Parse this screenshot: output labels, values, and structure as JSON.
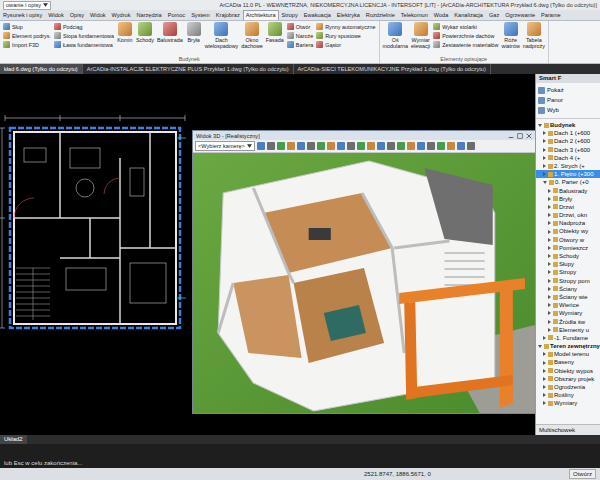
{
  "window": {
    "title": "ArCADia 11.0 PL - WEWNĘTRZNA, NIEKOMERCYJNA LICENCJA - INTERSOFT [LIT] - [ArCADia-ARCHITEKTURA Przykład 6.dwg (Tylko do odczytu)]"
  },
  "workspace": "owanie i opisy",
  "menu_tabs": [
    {
      "label": "Rysunek i opisy",
      "selected": false
    },
    {
      "label": "Widok",
      "selected": false
    },
    {
      "label": "Opisy",
      "selected": false
    },
    {
      "label": "Widok",
      "selected": false
    },
    {
      "label": "Wydruk",
      "selected": false
    },
    {
      "label": "Narzędzia",
      "selected": false
    },
    {
      "label": "Pomoc",
      "selected": false
    },
    {
      "label": "System",
      "selected": false
    },
    {
      "label": "Krajobraz",
      "selected": false
    },
    {
      "label": "Architektura",
      "selected": true
    },
    {
      "label": "Stropy",
      "selected": false
    },
    {
      "label": "Ewakuacja",
      "selected": false
    },
    {
      "label": "Elektryka",
      "selected": false
    },
    {
      "label": "Rozdzielnie",
      "selected": false
    },
    {
      "label": "Telekomun",
      "selected": false
    },
    {
      "label": "Woda",
      "selected": false
    },
    {
      "label": "Kanalizacja",
      "selected": false
    },
    {
      "label": "Gaz",
      "selected": false
    },
    {
      "label": "Ogrzewanie",
      "selected": false
    },
    {
      "label": "Parame",
      "selected": false
    }
  ],
  "ribbon": {
    "groups": [
      {
        "label": "Budynek",
        "items": [
          {
            "label": "Słup",
            "kind": "small"
          },
          {
            "label": "Element podrys.",
            "kind": "small"
          },
          {
            "label": "Import F3D",
            "kind": "small"
          },
          {
            "label": "Podciąg",
            "kind": "small"
          },
          {
            "label": "Stopa fundamentowa",
            "kind": "small"
          },
          {
            "label": "Ława fundamentowa",
            "kind": "small"
          },
          {
            "label": "Komin",
            "kind": "large"
          },
          {
            "label": "Schody",
            "kind": "large"
          },
          {
            "label": "Balustrada",
            "kind": "large"
          },
          {
            "label": "Bryła",
            "kind": "large"
          },
          {
            "label": "Dach wielospadowy",
            "kind": "large"
          },
          {
            "label": "Okno dachowe",
            "kind": "large"
          },
          {
            "label": "Fasada",
            "kind": "large"
          },
          {
            "label": "Otwór",
            "kind": "small"
          },
          {
            "label": "Naroże",
            "kind": "small"
          },
          {
            "label": "Bariera",
            "kind": "small"
          },
          {
            "label": "Rynny automatyczne",
            "kind": "small"
          },
          {
            "label": "Rury spustowe",
            "kind": "small"
          },
          {
            "label": "Gąsior",
            "kind": "small"
          }
        ]
      },
      {
        "label": "Elementy opisujące",
        "items": [
          {
            "label": "Oś modularna",
            "kind": "large"
          },
          {
            "label": "Wymiar elewacji",
            "kind": "large"
          },
          {
            "label": "Wykaz stolarki",
            "kind": "small"
          },
          {
            "label": "Powierzchnie dachów",
            "kind": "small"
          },
          {
            "label": "Zestawienie materiałów",
            "kind": "small"
          },
          {
            "label": "Róże wiatrów",
            "kind": "large"
          },
          {
            "label": "Tabela nadproży",
            "kind": "large"
          }
        ]
      }
    ]
  },
  "doc_tabs": [
    {
      "label": "kład 6.dwg (Tylko do odczytu)",
      "selected": true
    },
    {
      "label": "ArCADia-INSTALACJE ELEKTRYCZNE PLUS Przykład 1.dwg (Tylko do odczytu)",
      "selected": false
    },
    {
      "label": "ArCADia-SIECI TELEKOMUNIKACYJNE Przykład 1.dwg (Tylko do odczytu)",
      "selected": false
    }
  ],
  "view3d": {
    "title": "Widok 3D - [Realistyczny]",
    "camera": "<Wybierz kamerę>"
  },
  "panel": {
    "title": "Smart F",
    "buttons": [
      "Pokaż",
      "Panor",
      "Wyb"
    ],
    "bottom_tab": "Multischowek"
  },
  "tree": [
    {
      "label": "Budynek",
      "level": 0,
      "expanded": true,
      "selected": false
    },
    {
      "label": "Dach 1 (+600",
      "level": 1,
      "expanded": false,
      "selected": false
    },
    {
      "label": "Dach 2 (+600",
      "level": 1,
      "expanded": false,
      "selected": false
    },
    {
      "label": "Dach 3 (+600",
      "level": 1,
      "expanded": false,
      "selected": false
    },
    {
      "label": "Dach 4 (+",
      "level": 1,
      "expanded": false,
      "selected": false
    },
    {
      "label": "2. Strych (+",
      "level": 1,
      "expanded": false,
      "selected": false
    },
    {
      "label": "1. Piętro (+300",
      "level": 1,
      "expanded": false,
      "selected": true
    },
    {
      "label": "0. Parter (+0",
      "level": 1,
      "expanded": true,
      "selected": false
    },
    {
      "label": "Balustrady",
      "level": 2,
      "expanded": false,
      "selected": false
    },
    {
      "label": "Bryły",
      "level": 2,
      "expanded": false,
      "selected": false
    },
    {
      "label": "Drzwi",
      "level": 2,
      "expanded": false,
      "selected": false
    },
    {
      "label": "Drzwi, okn",
      "level": 2,
      "expanded": false,
      "selected": false
    },
    {
      "label": "Nadproża",
      "level": 2,
      "expanded": false,
      "selected": false
    },
    {
      "label": "Obiekty wy",
      "level": 2,
      "expanded": false,
      "selected": false
    },
    {
      "label": "Otwory w",
      "level": 2,
      "expanded": false,
      "selected": false
    },
    {
      "label": "Pomieszcz",
      "level": 2,
      "expanded": false,
      "selected": false
    },
    {
      "label": "Schody",
      "level": 2,
      "expanded": false,
      "selected": false
    },
    {
      "label": "Słupy",
      "level": 2,
      "expanded": false,
      "selected": false
    },
    {
      "label": "Stropy",
      "level": 2,
      "expanded": false,
      "selected": false
    },
    {
      "label": "Stropy pom",
      "level": 2,
      "expanded": false,
      "selected": false
    },
    {
      "label": "Ściany",
      "level": 2,
      "expanded": false,
      "selected": false
    },
    {
      "label": "Ściany wie",
      "level": 2,
      "expanded": false,
      "selected": false
    },
    {
      "label": "Wieńce",
      "level": 2,
      "expanded": false,
      "selected": false
    },
    {
      "label": "Wymiary",
      "level": 2,
      "expanded": false,
      "selected": false
    },
    {
      "label": "Źródła św",
      "level": 2,
      "expanded": false,
      "selected": false
    },
    {
      "label": "Elementy u",
      "level": 2,
      "expanded": false,
      "selected": false
    },
    {
      "label": "-1. Fundame",
      "level": 1,
      "expanded": false,
      "selected": false
    },
    {
      "label": "Teren zewnętrzny",
      "level": 0,
      "expanded": true,
      "selected": false
    },
    {
      "label": "Model terenu",
      "level": 1,
      "expanded": false,
      "selected": false
    },
    {
      "label": "Baseny",
      "level": 1,
      "expanded": false,
      "selected": false
    },
    {
      "label": "Obiekty wypos",
      "level": 1,
      "expanded": false,
      "selected": false
    },
    {
      "label": "Obszary projek",
      "level": 1,
      "expanded": false,
      "selected": false
    },
    {
      "label": "Ogrodzenia",
      "level": 1,
      "expanded": false,
      "selected": false
    },
    {
      "label": "Rośliny",
      "level": 1,
      "expanded": false,
      "selected": false
    },
    {
      "label": "Wymiary",
      "level": 1,
      "expanded": false,
      "selected": false
    }
  ],
  "layout_tabs": [
    {
      "label": "Układ2",
      "selected": true
    }
  ],
  "command": {
    "prompt": "lub Esc w celu zakończenia..."
  },
  "status": {
    "coords": "2521.8747, 1886.5671, 0",
    "button": "Otwórz"
  }
}
